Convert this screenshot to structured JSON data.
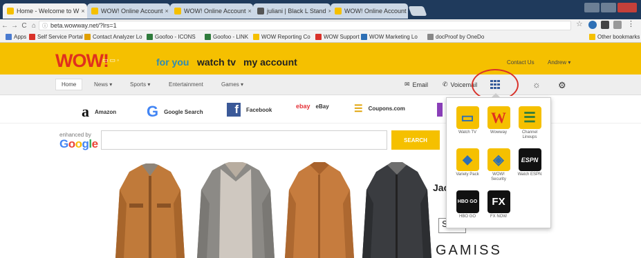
{
  "tabs": [
    {
      "label": "Home - Welcome to W",
      "active": true
    },
    {
      "label": "WOW! Online Account"
    },
    {
      "label": "WOW! Online Account"
    },
    {
      "label": "juliani | Black L Stand"
    },
    {
      "label": "WOW! Online Account"
    }
  ],
  "address": {
    "url": "beta.wowway.net/?lrs=1"
  },
  "bookmarks": [
    {
      "label": "Apps",
      "color": "#4a7bd0"
    },
    {
      "label": "Self Service Portal",
      "color": "#d9322a"
    },
    {
      "label": "Contact Analyzer Lo",
      "color": "#e0a000"
    },
    {
      "label": "Goofoo - ICONS",
      "color": "#2f7b3c"
    },
    {
      "label": "Goofoo - LINK",
      "color": "#2f7b3c"
    },
    {
      "label": "WOW Reporting Co",
      "color": "#f5c000"
    },
    {
      "label": "WOW Support",
      "color": "#d9322a"
    },
    {
      "label": "WOW Marketing Lo",
      "color": "#2d6fb5"
    },
    {
      "label": "docProof by OneDo",
      "color": "#888888"
    },
    {
      "label": "Other bookmarks",
      "color": "#f5c000"
    }
  ],
  "header": {
    "logo": "WOW!",
    "nav": [
      "for you",
      "watch tv",
      "my account"
    ],
    "contact": "Contact Us",
    "user": "Andrew ▾"
  },
  "subnav": {
    "items": [
      "Home",
      "News ▾",
      "Sports ▾",
      "Entertainment",
      "Games ▾"
    ],
    "email": "Email",
    "voicemail": "Voicemail"
  },
  "quicklinks": [
    {
      "label": "Amazon",
      "icon": "a",
      "color": "#111111"
    },
    {
      "label": "Google Search",
      "icon": "G",
      "color": "#4285f4"
    },
    {
      "label": "Facebook",
      "icon": "f",
      "color": "#3b5998"
    },
    {
      "label": "eBay",
      "icon": "ebay",
      "color": "#e53238"
    },
    {
      "label": "Coupons.com",
      "icon": "☰",
      "color": "#e0a000"
    }
  ],
  "search": {
    "enhanced_label": "enhanced by",
    "google": "Google",
    "button": "SEARCH",
    "value": ""
  },
  "product": {
    "title": "Jac",
    "search_fragment": "S",
    "brand": "GAMISS"
  },
  "apps": [
    {
      "label": "Watch TV",
      "glyph": "▭",
      "bg": "#f5c000",
      "fg": "#2d6fb5"
    },
    {
      "label": "Wowway",
      "glyph": "W",
      "bg": "#f5c000",
      "fg": "#e0301e"
    },
    {
      "label": "Channel Lineups",
      "glyph": "☰",
      "bg": "#f5c000",
      "fg": "#2f7b3c"
    },
    {
      "label": "Variety Pack",
      "glyph": "◆",
      "bg": "#f5c000",
      "fg": "#2d6fb5"
    },
    {
      "label": "WOW! Security",
      "glyph": "◈",
      "bg": "#f5c000",
      "fg": "#2d6fb5"
    },
    {
      "label": "Watch ESPN",
      "glyph": "ESPN",
      "bg": "#111111",
      "fg": "#ffffff"
    },
    {
      "label": "HBO GO",
      "glyph": "HBO GO",
      "bg": "#111111",
      "fg": "#ffffff"
    },
    {
      "label": "FX NOW",
      "glyph": "FX",
      "bg": "#111111",
      "fg": "#ffffff"
    }
  ],
  "colors": {
    "brand_yellow": "#f5c000",
    "brand_red": "#e0301e",
    "link_blue": "#2d8cb5",
    "highlight_ring": "#d9322a"
  }
}
